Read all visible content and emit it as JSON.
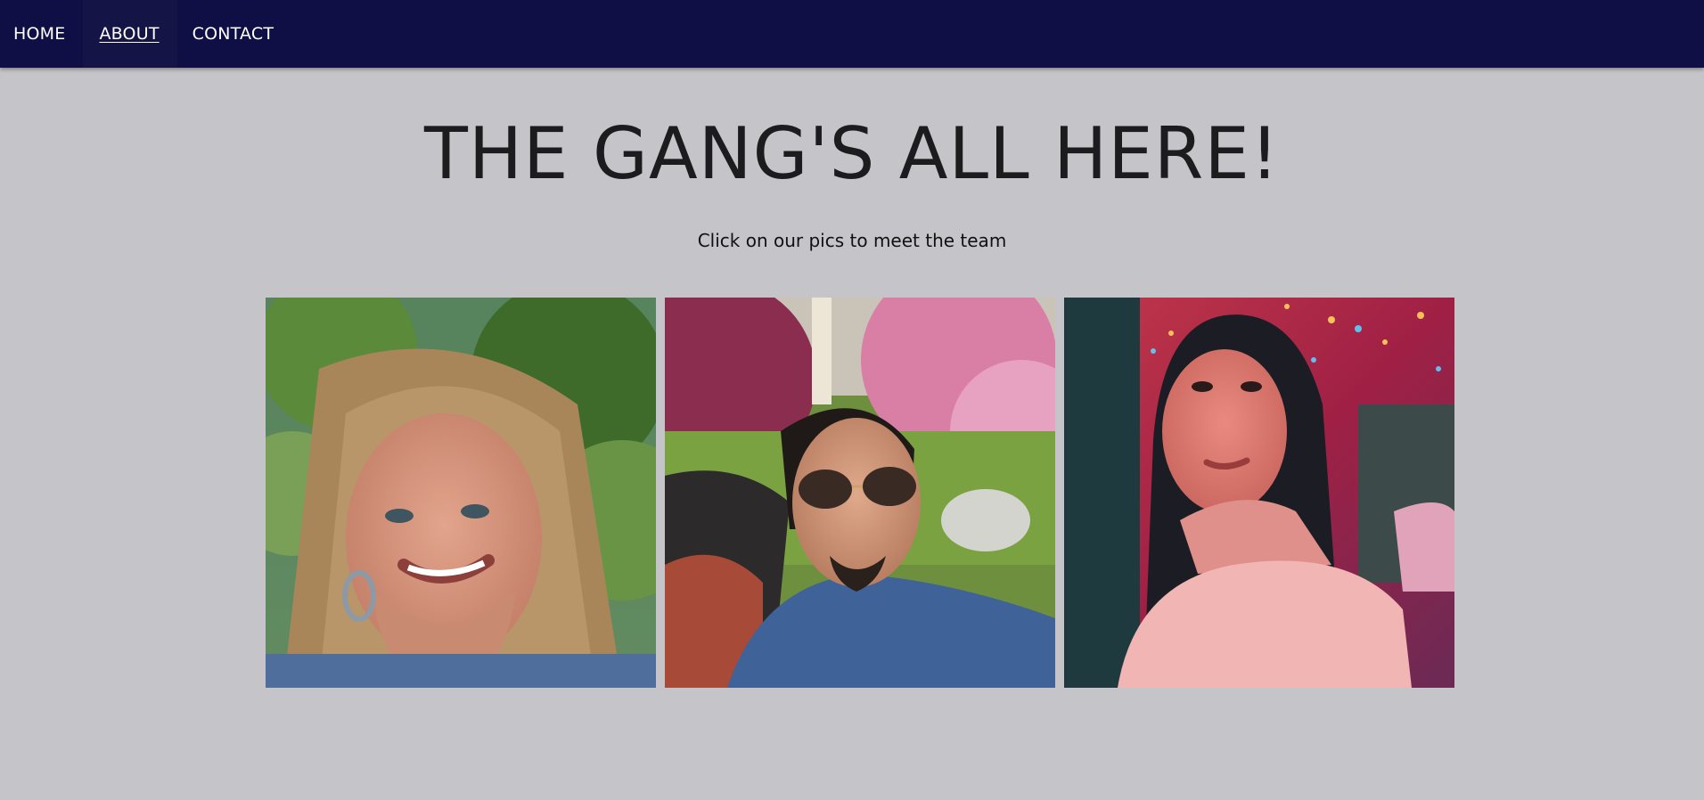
{
  "nav": {
    "items": [
      {
        "label": "HOME"
      },
      {
        "label": "ABOUT",
        "active": true
      },
      {
        "label": "CONTACT"
      }
    ]
  },
  "page": {
    "title": "THE GANG'S ALL HERE!",
    "subtitle": "Click on our pics to meet the team"
  },
  "team_photos": [
    {
      "description_icon": "person-photo-icon"
    },
    {
      "description_icon": "person-photo-icon"
    },
    {
      "description_icon": "person-photo-icon"
    }
  ],
  "colors": {
    "navbar": "#100f45",
    "background": "#c5c4c9",
    "title": "#1c1c1e"
  }
}
